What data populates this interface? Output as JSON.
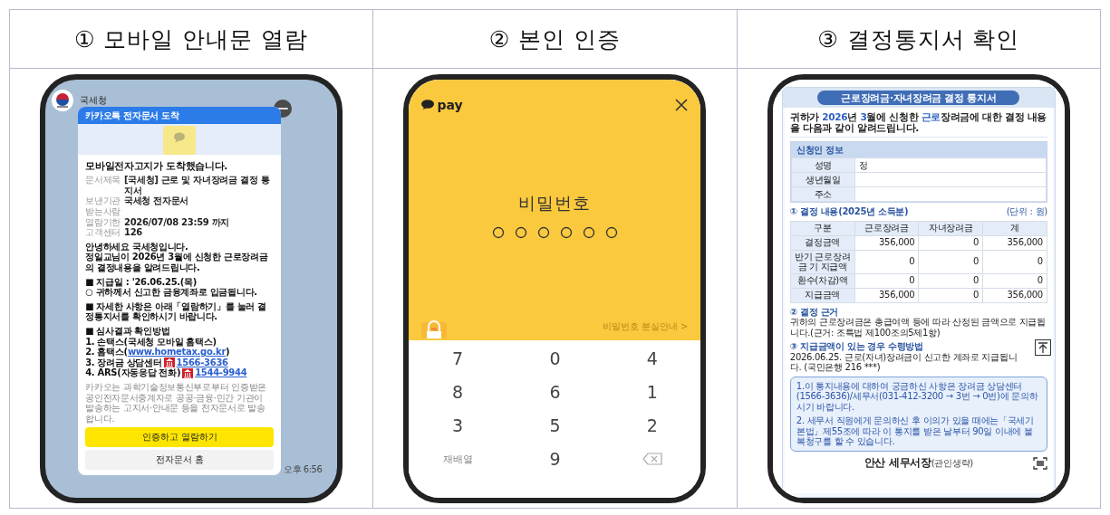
{
  "steps": [
    {
      "heading": "① 모바일 안내문 열람",
      "screen": {
        "kind": "kakao",
        "sender": "국세청",
        "card_title": "카카오톡 전자문서 도착",
        "headline": "모바일전자고지가 도착했습니다.",
        "fields": [
          {
            "label": "문서제목",
            "value": "[국세청] 근로 및 자녀장려금 결정 통지서"
          },
          {
            "label": "보낸기관",
            "value": "국세청 전자문서"
          },
          {
            "label": "받는사람"
          },
          {
            "label": "열람기한",
            "value": "2026/07/08 23:59 까지"
          },
          {
            "label": "고객센터",
            "value": "126"
          }
        ],
        "paragraphs": [
          {
            "lines": [
              "안녕하세요 국세청입니다.",
              "정일교님이 2026년 3월에 신청한 근로장려금의 결정내용을 알려드립니다."
            ]
          },
          {
            "lines": [
              "■ 지급일 : '26.06.25.(목)",
              "○ 귀하께서 신고한 금융계좌로 입금됩니다."
            ]
          },
          {
            "lines": [
              "■ 자세한 사항은 아래「열람하기」를 눌러 결정통지서를 확인하시기 바랍니다."
            ]
          }
        ],
        "methods": {
          "title": "■ 심사결과 확인방법",
          "items": [
            {
              "kind": "plain",
              "text": "1. 손택스(국세청 모바일 홈택스)"
            },
            {
              "kind": "link",
              "text": "2. 홈택스(",
              "link": "www.hometax.go.kr",
              "after": ")"
            },
            {
              "kind": "phone",
              "text": "3. 장려금 상담센터",
              "link": "1566-3636"
            },
            {
              "kind": "phone",
              "text": "4. ARS(자동응답 전화)",
              "link": "1544-9944"
            }
          ]
        },
        "disclaimer": "카카오는 과학기술정보통신부로부터 인증받은 공인전자문서중계자로 공공·금융·민간 기관이 발송하는 고지서·안내문 등을 전자문서로 발송합니다.",
        "buttons": [
          {
            "kind": "primary",
            "label": "인증하고 열람하기"
          },
          {
            "kind": "secondary",
            "label": "전자문서 홈"
          }
        ],
        "time": "오후 6:56"
      }
    },
    {
      "heading": "② 본인 인증",
      "screen": {
        "kind": "pay",
        "brand": "pay",
        "title": "비밀번호",
        "pin_dots": [
          {
            "filled": false
          },
          {
            "filled": false
          },
          {
            "filled": false
          },
          {
            "filled": false
          },
          {
            "filled": false
          },
          {
            "filled": false
          }
        ],
        "lost_link": "비밀번호 분실안내 >",
        "keys": [
          {
            "kind": "digit",
            "label": "7"
          },
          {
            "kind": "digit",
            "label": "0"
          },
          {
            "kind": "digit",
            "label": "4"
          },
          {
            "kind": "digit",
            "label": "8"
          },
          {
            "kind": "digit",
            "label": "6"
          },
          {
            "kind": "digit",
            "label": "1"
          },
          {
            "kind": "digit",
            "label": "3"
          },
          {
            "kind": "digit",
            "label": "5"
          },
          {
            "kind": "digit",
            "label": "2"
          },
          {
            "kind": "text",
            "label": "재배열"
          },
          {
            "kind": "digit",
            "label": "9"
          },
          {
            "kind": "backspace"
          }
        ]
      }
    },
    {
      "heading": "③ 결정통지서 확인",
      "screen": {
        "kind": "notice",
        "title": "근로장려금·자녀장려금 결정 통지서",
        "intro": "귀하가 **2026**년 **3**월에 신청한 **근로**장려금에 대한 결정 내용을 다음과 같이 알려드립니다.",
        "applicant": {
          "title": "신청인 정보",
          "rows": [
            {
              "label": "성명",
              "value": "정"
            },
            {
              "label": "생년월일"
            },
            {
              "label": "주소"
            }
          ]
        },
        "decision": {
          "title": "① 결정 내용(2025년 소득분)",
          "unit": "(단위 : 원)",
          "columns": [
            "구분",
            "근로장려금",
            "자녀장려금",
            "계"
          ],
          "rows": [
            [
              "결정금액",
              "356,000",
              "0",
              "356,000"
            ],
            [
              "반기 근로장려금 기 지급액",
              "0",
              "0",
              "0"
            ],
            [
              "환수(차감)액",
              "0",
              "0",
              "0"
            ],
            [
              "지급금액",
              "356,000",
              "0",
              "356,000"
            ]
          ]
        },
        "sections": [
          {
            "title": "② 결정 근거",
            "body": "귀하의 근로장려금은 총급여액 등에 따라 산정된 금액으로 지급됩니다.(근거: 조특법 제100조의5제1항)"
          },
          {
            "title": "③ 지급금액이 있는 경우 수령방법",
            "body": "2026.06.25. 근로(자녀)장려금이 신고한 계좌로 지급됩니다. (국민은행 216 ***)"
          }
        ],
        "notes": [
          "1.이 통지내용에 대하여 궁금하신 사항은 장려금 상담센터(1566-3636)/세무서(031-412-3200 → 3번 → 0번)에 문의하시기 바랍니다.",
          "2. 세무서 직원에게 문의하신 후 이의가 있을 때에는「국세기본법」제55조에 따라 이 통지를 받은 날부터 90일 이내에 불복청구를 할 수 있습니다."
        ],
        "issuer": "안산 세무서장",
        "seal_note": "(관인생략)"
      }
    }
  ]
}
